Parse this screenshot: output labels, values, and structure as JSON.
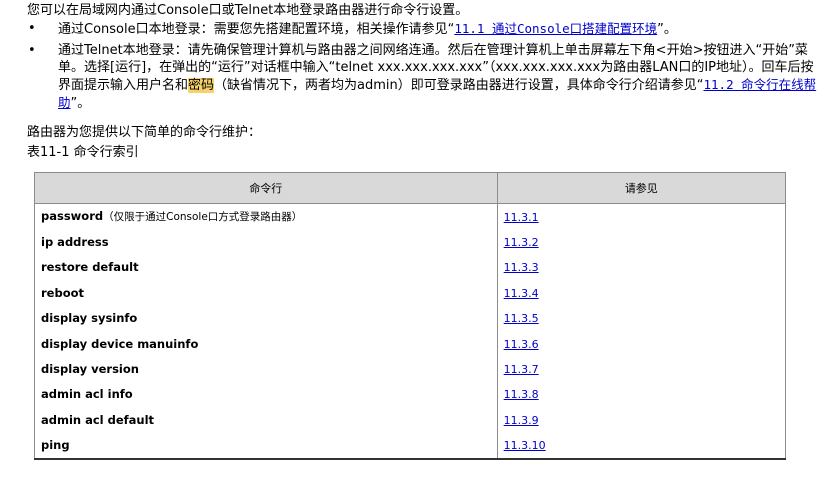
{
  "intro": "您可以在局域网内通过Console口或Telnet本地登录路由器进行命令行设置。",
  "bullets": {
    "b1": {
      "text": "通过Console口本地登录：需要您先搭建配置环境，相关操作请参见“",
      "link": "11.1  通过Console口搭建配置环境",
      "after": "”。"
    },
    "b2": {
      "text1": "通过Telnet本地登录：请先确保管理计算机与路由器之间网络连通。然后在管理计算机上单击屏幕左下角<开始>按钮进入“开始”菜单。选择[运行]，在弹出的“运行”对话框中输入“telnet xxx.xxx.xxx.xxx”（xxx.xxx.xxx.xxx为路由器LAN口的IP地址）。回车后按界面提示输入用户名和",
      "highlight": "密码",
      "text2": "（缺省情况下，两者均为admin）即可登录路由器进行设置，具体命令行介绍请参见“",
      "link": "11.2  命令行在线帮助",
      "after": "”。"
    }
  },
  "para2": "路由器为您提供以下简单的命令行维护：",
  "caption": "表11-1 命令行索引",
  "table": {
    "headers": [
      "命令行",
      "请参见"
    ],
    "rows": [
      {
        "cmd": "password",
        "note": "（仅限于通过Console口方式登录路由器）",
        "ref": "11.3.1"
      },
      {
        "cmd": "ip address",
        "note": "",
        "ref": "11.3.2"
      },
      {
        "cmd": "restore default",
        "note": "",
        "ref": "11.3.3"
      },
      {
        "cmd": "reboot",
        "note": "",
        "ref": "11.3.4"
      },
      {
        "cmd": "display sysinfo",
        "note": "",
        "ref": "11.3.5"
      },
      {
        "cmd": "display device manuinfo",
        "note": "",
        "ref": "11.3.6"
      },
      {
        "cmd": "display version",
        "note": "",
        "ref": "11.3.7"
      },
      {
        "cmd": "admin acl info",
        "note": "",
        "ref": "11.3.8"
      },
      {
        "cmd": "admin acl default",
        "note": "",
        "ref": "11.3.9"
      },
      {
        "cmd": "ping",
        "note": "",
        "ref": "11.3.10"
      }
    ]
  }
}
